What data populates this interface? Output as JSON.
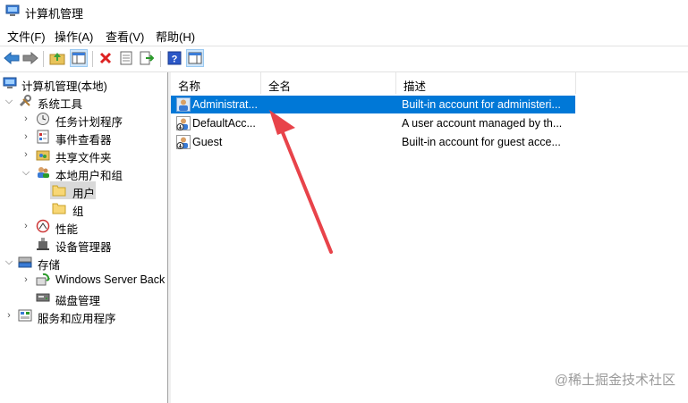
{
  "window": {
    "title": "计算机管理"
  },
  "menu": [
    "文件(F)",
    "操作(A)",
    "查看(V)",
    "帮助(H)"
  ],
  "toolbar": {
    "buttons": [
      "back-icon",
      "forward-icon",
      "up-folder-icon",
      "show-tree-icon",
      "delete-icon",
      "properties-icon",
      "export-icon",
      "help-icon",
      "action-pane-icon"
    ]
  },
  "tree": {
    "root": "计算机管理(本地)",
    "system_tools": "系统工具",
    "task_scheduler": "任务计划程序",
    "event_viewer": "事件查看器",
    "shared_folders": "共享文件夹",
    "local_users_groups": "本地用户和组",
    "users": "用户",
    "groups": "组",
    "performance": "性能",
    "device_manager": "设备管理器",
    "storage": "存储",
    "windows_server_backup": "Windows Server Back",
    "disk_management": "磁盘管理",
    "services_apps": "服务和应用程序"
  },
  "list": {
    "columns": {
      "name": "名称",
      "fullname": "全名",
      "description": "描述"
    },
    "rows": [
      {
        "name": "Administrat...",
        "fullname": "",
        "description": "Built-in account for administeri..."
      },
      {
        "name": "DefaultAcc...",
        "fullname": "",
        "description": "A user account managed by th..."
      },
      {
        "name": "Guest",
        "fullname": "",
        "description": "Built-in account for guest acce..."
      }
    ]
  },
  "watermark": "@稀土掘金技术社区",
  "colors": {
    "selection": "#0078d7",
    "annotation_arrow": "#e8434a",
    "tree_selection": "#d9d9d9"
  }
}
